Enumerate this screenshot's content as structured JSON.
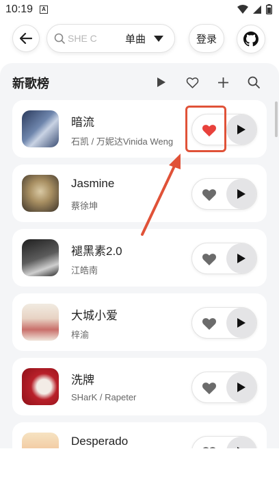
{
  "status_bar": {
    "time": "10:19",
    "app_icon_letter": "A"
  },
  "search": {
    "placeholder": "SHE C",
    "type_label": "单曲"
  },
  "login_label": "登录",
  "list": {
    "title": "新歌榜",
    "songs": [
      {
        "title": "暗流",
        "artist": "石凯 / 万妮达Vinida Weng",
        "liked": true
      },
      {
        "title": "Jasmine",
        "artist": "蔡徐坤",
        "liked": false
      },
      {
        "title": "褪黑素2.0",
        "artist": "江皓南",
        "liked": false
      },
      {
        "title": "大城小爱",
        "artist": "梓渝",
        "liked": false
      },
      {
        "title": "洗牌",
        "artist": "SHarK / Rapeter",
        "liked": false
      },
      {
        "title": "Desperado",
        "artist": "",
        "liked": false
      }
    ]
  },
  "colors": {
    "liked_heart": "#e8413c",
    "unliked_heart": "#6b6b6b",
    "annotation": "#e05238",
    "panel_bg": "#f4f5f7"
  },
  "icons": [
    "back-arrow-icon",
    "search-icon",
    "caret-down-icon",
    "github-icon",
    "play-icon",
    "heart-icon",
    "plus-icon"
  ]
}
